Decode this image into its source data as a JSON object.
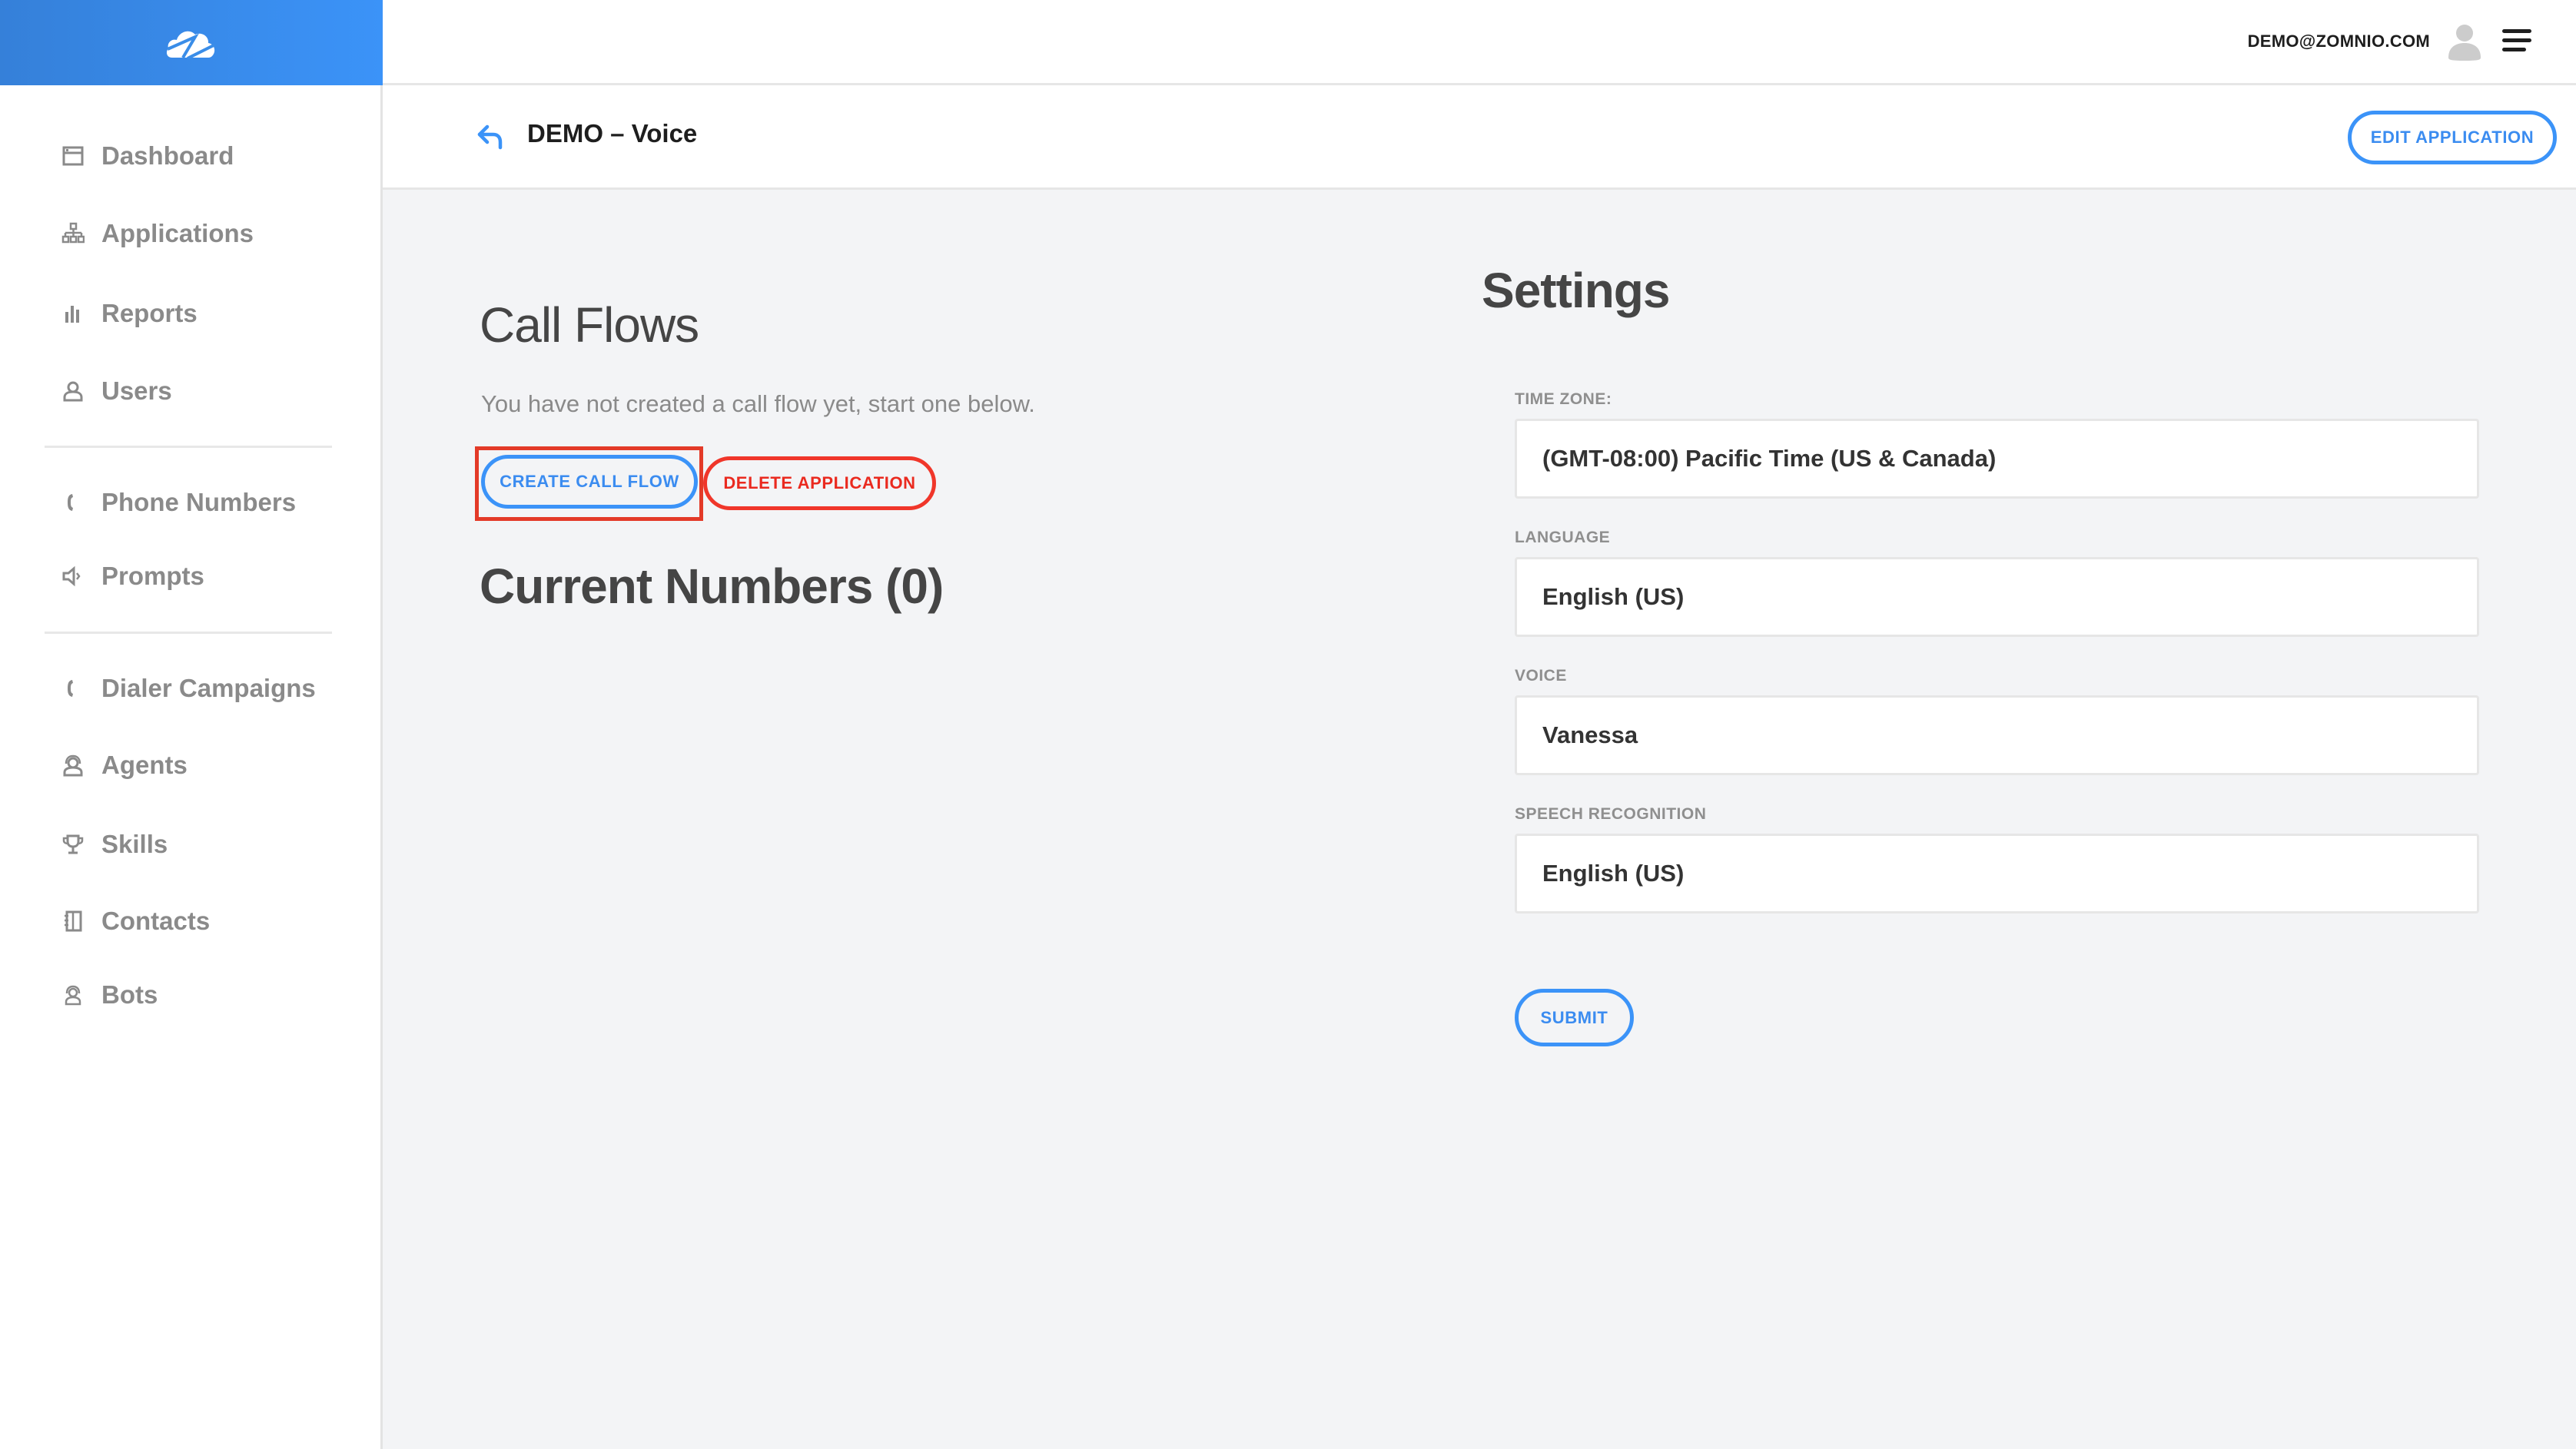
{
  "brand": {
    "logo_icon": "cloud-logo-icon",
    "colors": {
      "brand_gradient_start": "#3580d9",
      "brand_gradient_end": "#3b93f8",
      "primary": "#3b93f8",
      "danger": "#f0362a",
      "highlight_box": "#e33a28",
      "background": "#f3f4f6"
    }
  },
  "topbar": {
    "user_email": "DEMO@ZOMNIO.COM",
    "avatar_icon": "user-avatar-icon",
    "menu_icon": "hamburger-menu-icon"
  },
  "sidebar": {
    "groups": [
      [
        {
          "label": "Dashboard",
          "icon": "dashboard-icon"
        },
        {
          "label": "Applications",
          "icon": "sitemap-icon"
        },
        {
          "label": "Reports",
          "icon": "bar-chart-icon"
        },
        {
          "label": "Users",
          "icon": "user-icon"
        }
      ],
      [
        {
          "label": "Phone Numbers",
          "icon": "phone-icon"
        },
        {
          "label": "Prompts",
          "icon": "speaker-icon"
        }
      ],
      [
        {
          "label": "Dialer Campaigns",
          "icon": "phone-icon"
        },
        {
          "label": "Agents",
          "icon": "headset-agent-icon"
        },
        {
          "label": "Skills",
          "icon": "trophy-icon"
        },
        {
          "label": "Contacts",
          "icon": "address-book-icon"
        },
        {
          "label": "Bots",
          "icon": "headset-bot-icon"
        }
      ]
    ]
  },
  "page_header": {
    "back_icon": "back-arrow-icon",
    "title": "DEMO – Voice",
    "edit_button": "EDIT APPLICATION"
  },
  "call_flows": {
    "title": "Call Flows",
    "empty_message": "You have not created a call flow yet, start one below.",
    "create_button": "CREATE CALL FLOW",
    "delete_button": "DELETE APPLICATION"
  },
  "current_numbers": {
    "title": "Current Numbers (0)",
    "count": 0
  },
  "settings": {
    "title": "Settings",
    "fields": [
      {
        "label": "TIME ZONE:",
        "value": "(GMT-08:00) Pacific Time (US & Canada)"
      },
      {
        "label": "LANGUAGE",
        "value": "English (US)"
      },
      {
        "label": "VOICE",
        "value": "Vanessa"
      },
      {
        "label": "SPEECH RECOGNITION",
        "value": "English (US)"
      }
    ],
    "submit_button": "SUBMIT"
  }
}
